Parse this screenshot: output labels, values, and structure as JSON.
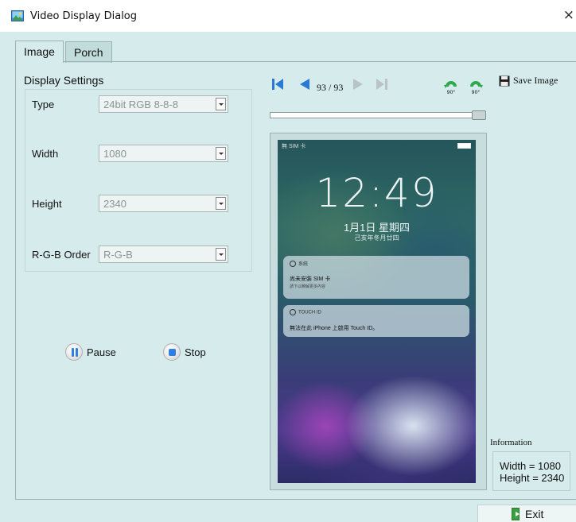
{
  "window": {
    "title": "Video Display Dialog",
    "close_glyph": "×"
  },
  "tabs": [
    {
      "label": "Image",
      "active": true
    },
    {
      "label": "Porch",
      "active": false
    }
  ],
  "display_settings": {
    "title": "Display Settings",
    "fields": [
      {
        "label": "Type",
        "value": "24bit RGB 8-8-8"
      },
      {
        "label": "Width",
        "value": "1080"
      },
      {
        "label": "Height",
        "value": "2340"
      },
      {
        "label": "R-G-B Order",
        "value": "R-G-B"
      }
    ]
  },
  "controls": {
    "pause_label": "Pause",
    "stop_label": "Stop"
  },
  "navigation": {
    "page_indicator": "93 / 93",
    "slider_position_fraction": 1.0,
    "rotate_left_label": "90°",
    "rotate_right_label": "90°",
    "save_image_label": "Save Image"
  },
  "phone_screen": {
    "status_text": "無 SIM 卡",
    "time": "12:49",
    "date": "1月1日 星期四",
    "lunar_date": "己亥年冬月廿四",
    "notifications": [
      {
        "app": "系統",
        "line1": "尚未安裝 SIM 卡",
        "line2": "請下以瞭解更多內容"
      },
      {
        "app": "TOUCH ID",
        "line1": "無法在此 iPhone 上啟用 Touch ID。",
        "line2": ""
      }
    ]
  },
  "information": {
    "title": "Information",
    "width_line": "Width = 1080",
    "height_line": "Height = 2340"
  },
  "footer": {
    "exit_label": "Exit"
  },
  "colors": {
    "background": "#d6ecec",
    "accent_blue": "#2f7fe0",
    "nav_blue": "#2a7bd6",
    "rotate_green": "#2fa84f"
  }
}
